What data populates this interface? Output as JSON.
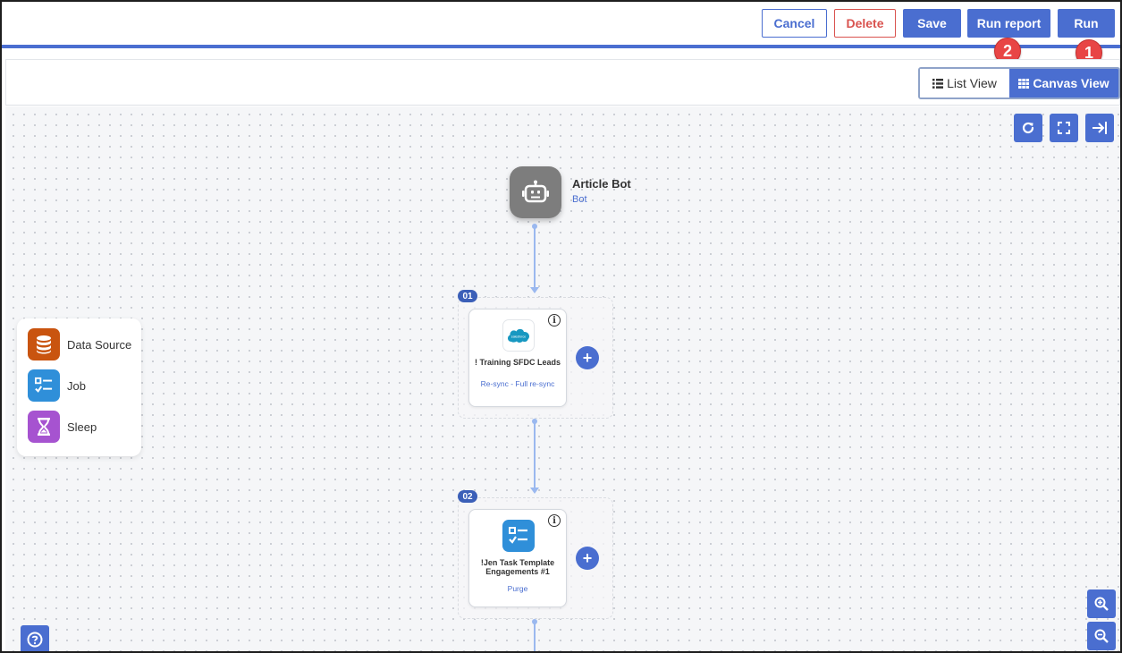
{
  "toolbar": {
    "cancel": "Cancel",
    "delete": "Delete",
    "save": "Save",
    "run_report": "Run report",
    "run": "Run"
  },
  "annotations": {
    "run_report_badge": "2",
    "run_badge": "1"
  },
  "view_toggle": {
    "list": "List View",
    "canvas": "Canvas View",
    "active": "canvas"
  },
  "canvas_controls": [
    "refresh-icon",
    "fullscreen-icon",
    "collapse-panel-icon",
    "zoom-in-icon",
    "zoom-out-icon"
  ],
  "bot": {
    "name": "Article Bot",
    "type": "Bot"
  },
  "steps": [
    {
      "number": "01",
      "title": "! Training SFDC Leads",
      "subtitle": "Re-sync - Full re-sync",
      "icon": "salesforce-logo",
      "logo_text": "salesforce"
    },
    {
      "number": "02",
      "title": "!Jen Task Template Engagements #1",
      "subtitle": "Purge",
      "icon": "job-checklist-icon"
    }
  ],
  "legend": [
    {
      "label": "Data Source",
      "color": "#c9540f",
      "icon": "database-icon"
    },
    {
      "label": "Job",
      "color": "#2f8fd9",
      "icon": "checklist-icon"
    },
    {
      "label": "Sleep",
      "color": "#a653d0",
      "icon": "hourglass-icon"
    }
  ],
  "colors": {
    "primary": "#4a6ed0",
    "danger": "#d9534f",
    "badge": "#e84545",
    "connector": "#9ab8ef"
  }
}
